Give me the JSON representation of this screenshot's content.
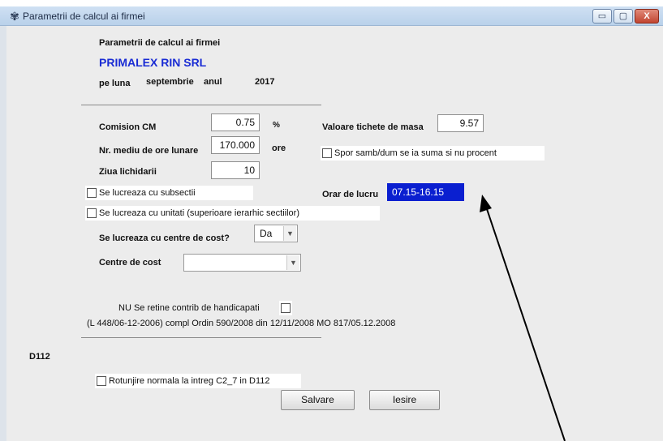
{
  "window": {
    "title": "Parametrii de calcul ai firmei",
    "icon": "application-icon"
  },
  "titlebar_buttons": {
    "minimize": "▭",
    "maximize": "▢",
    "close": "X"
  },
  "header": {
    "title": "Parametrii de calcul ai firmei",
    "firm": "PRIMALEX RIN SRL",
    "pe_luna": "pe luna",
    "month": "septembrie",
    "anul": "anul",
    "year": "2017"
  },
  "fields": {
    "comision_label": "Comision CM",
    "comision_value": "0.75",
    "comision_unit": "%",
    "ore_label": "Nr. mediu de ore lunare",
    "ore_value": "170.000",
    "ore_unit": "ore",
    "ziua_label": "Ziua lichidarii",
    "ziua_value": "10",
    "tichete_label": "Valoare tichete de masa",
    "tichete_value": "9.57",
    "orar_label": "Orar de lucru",
    "orar_value": "07.15-16.15"
  },
  "checkboxes": {
    "spor": "Spor samb/dum se ia suma si nu procent",
    "subsectii": "Se lucreaza cu subsectii",
    "unitati": "Se lucreaza cu unitati (superioare ierarhic  sectiilor)",
    "handicapati": "NU Se retine contrib de handicapati",
    "rotunjire": "Rotunjire normala  la intreg C2_7 in D112"
  },
  "centre": {
    "question": "Se lucreaza cu centre de cost?",
    "value": "Da",
    "cost_label": "Centre de cost",
    "cost_value": ""
  },
  "legal_note": "(L 448/06-12-2006) compl Ordin 590/2008 din 12/11/2008 MO 817/05.12.2008",
  "section": {
    "d112": "D112"
  },
  "buttons": {
    "save": "Salvare",
    "exit": "Iesire"
  },
  "colors": {
    "selection": "#0a1fd0",
    "firm_name": "#1a2cd4"
  }
}
